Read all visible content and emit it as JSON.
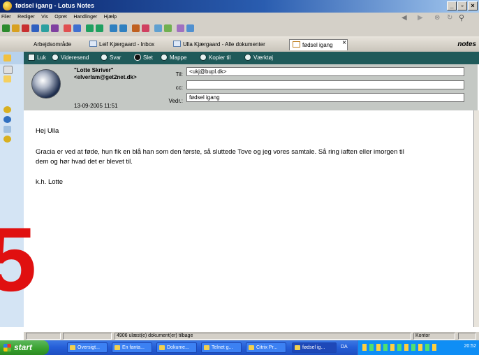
{
  "window": {
    "title": "fødsel igang - Lotus Notes"
  },
  "menu": [
    "Filer",
    "Rediger",
    "Vis",
    "Opret",
    "Handlinger",
    "Hjælp"
  ],
  "tabs": [
    {
      "label": "Arbejdsområde"
    },
    {
      "label": "Leif Kjærgaard - Inbox"
    },
    {
      "label": "Ulla Kjærgaard - Alle dokumenter"
    },
    {
      "label": "fødsel igang"
    }
  ],
  "tab_close": "×",
  "brand": "notes",
  "actions": [
    "Luk",
    "Videresend",
    "Svar",
    "Slet",
    "Mappe",
    "Kopier til",
    "Værktøj"
  ],
  "memo": {
    "sender_name": "\"Lotte Skriver\"",
    "sender_email": "<elverlam@get2net.dk>",
    "date": "13-09-2005 11:51",
    "to_label": "Til:",
    "to_value": "<ukj@bupl.dk>",
    "cc_label": "cc:",
    "cc_value": "",
    "subject_label": "Vedr.:",
    "subject_value": "fødsel igang"
  },
  "body": {
    "greeting": "Hej Ulla",
    "line1": "Gracia er ved at føde, hun fik en blå han som den første, så sluttede Tove og jeg vores samtale. Så ring iaften eller imorgen til",
    "line2": "dem og hør hvad det er blevet til.",
    "signoff": "k.h. Lotte"
  },
  "status": {
    "unread": "4906 ulæst(e) dokument(er) tilbage",
    "location": "Kontor"
  },
  "taskbar": {
    "start": "start",
    "tasks": [
      "Oversigt...",
      "En fanta...",
      "Dokume...",
      "Telnet g...",
      "Citrix Pr...",
      "fødsel ig..."
    ],
    "lang": "DA",
    "clock": "20:52"
  },
  "overlay_digit": "5",
  "colors": {
    "action_bar": "#1f5a5a",
    "title_bar": "#0a246a",
    "taskbar": "#245dd7",
    "start": "#37a02d",
    "overlay": "#e01010"
  }
}
